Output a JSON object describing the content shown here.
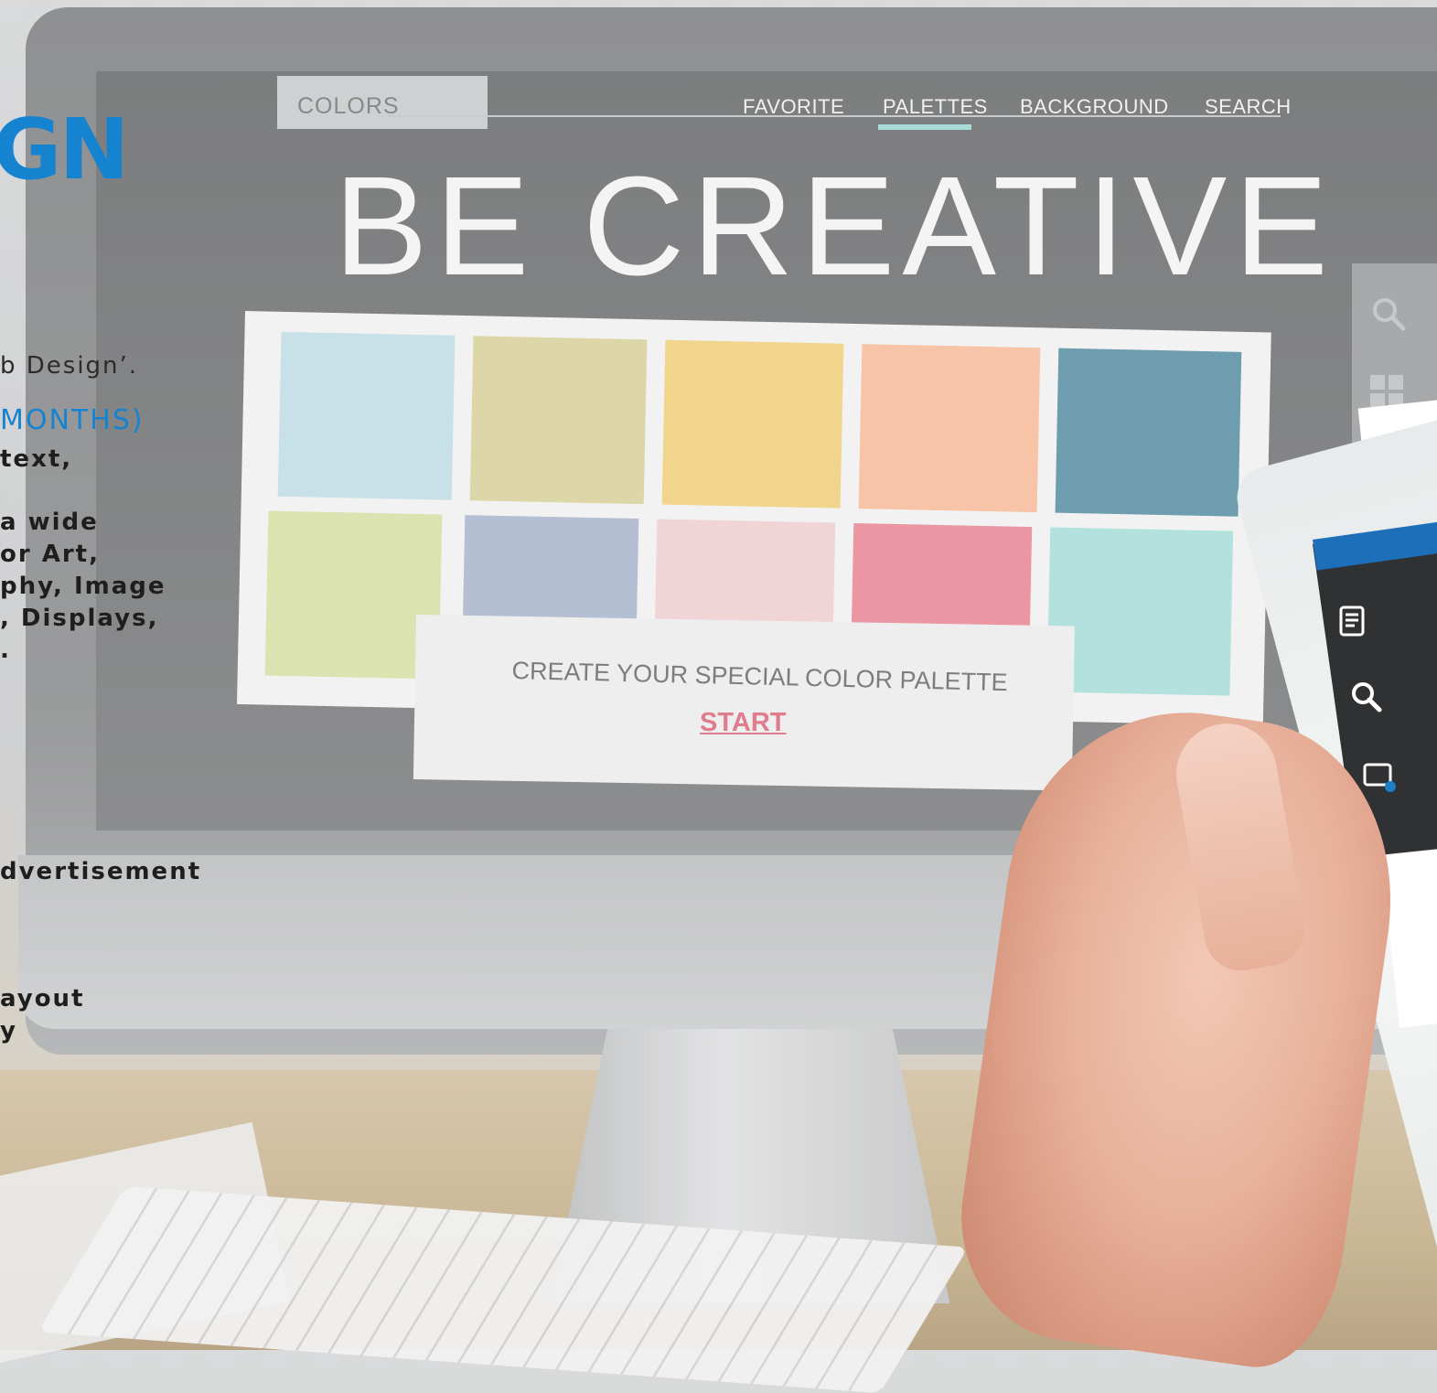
{
  "left_copy": {
    "heading": "GN",
    "lines": [
      "b Design’.",
      "MONTHS)",
      "text,",
      "a wide",
      "or Art,",
      "phy, Image",
      ", Displays,",
      ".",
      "dvertisement",
      "ayout",
      "y"
    ]
  },
  "screen_ui": {
    "colors_label": "COLORS",
    "nav": [
      "FAVORITE",
      "PALETTES",
      "BACKGROUND",
      "SEARCH"
    ],
    "active_nav": "PALETTES",
    "headline": "BE CREATIVE",
    "cta_text": "CREATE YOUR SPECIAL COLOR PALETTE",
    "cta_button": "START"
  },
  "palette_colors": {
    "row1": [
      "#c8e0e8",
      "#dcd6a8",
      "#f2d58c",
      "#f8c4a8",
      "#6e9db0"
    ],
    "row2": [
      "#dbe3b0",
      "#b4bfd4",
      "#f0d4d6",
      "#ec95a3",
      "#b3e2de"
    ]
  },
  "icons": [
    "search-icon",
    "grid-icon",
    "document-icon",
    "search-icon",
    "window-icon"
  ],
  "accent_colors": {
    "brand_blue": "#1683d1",
    "cta_pink": "#e07d8d",
    "active_tab": "#a9dcd6"
  }
}
